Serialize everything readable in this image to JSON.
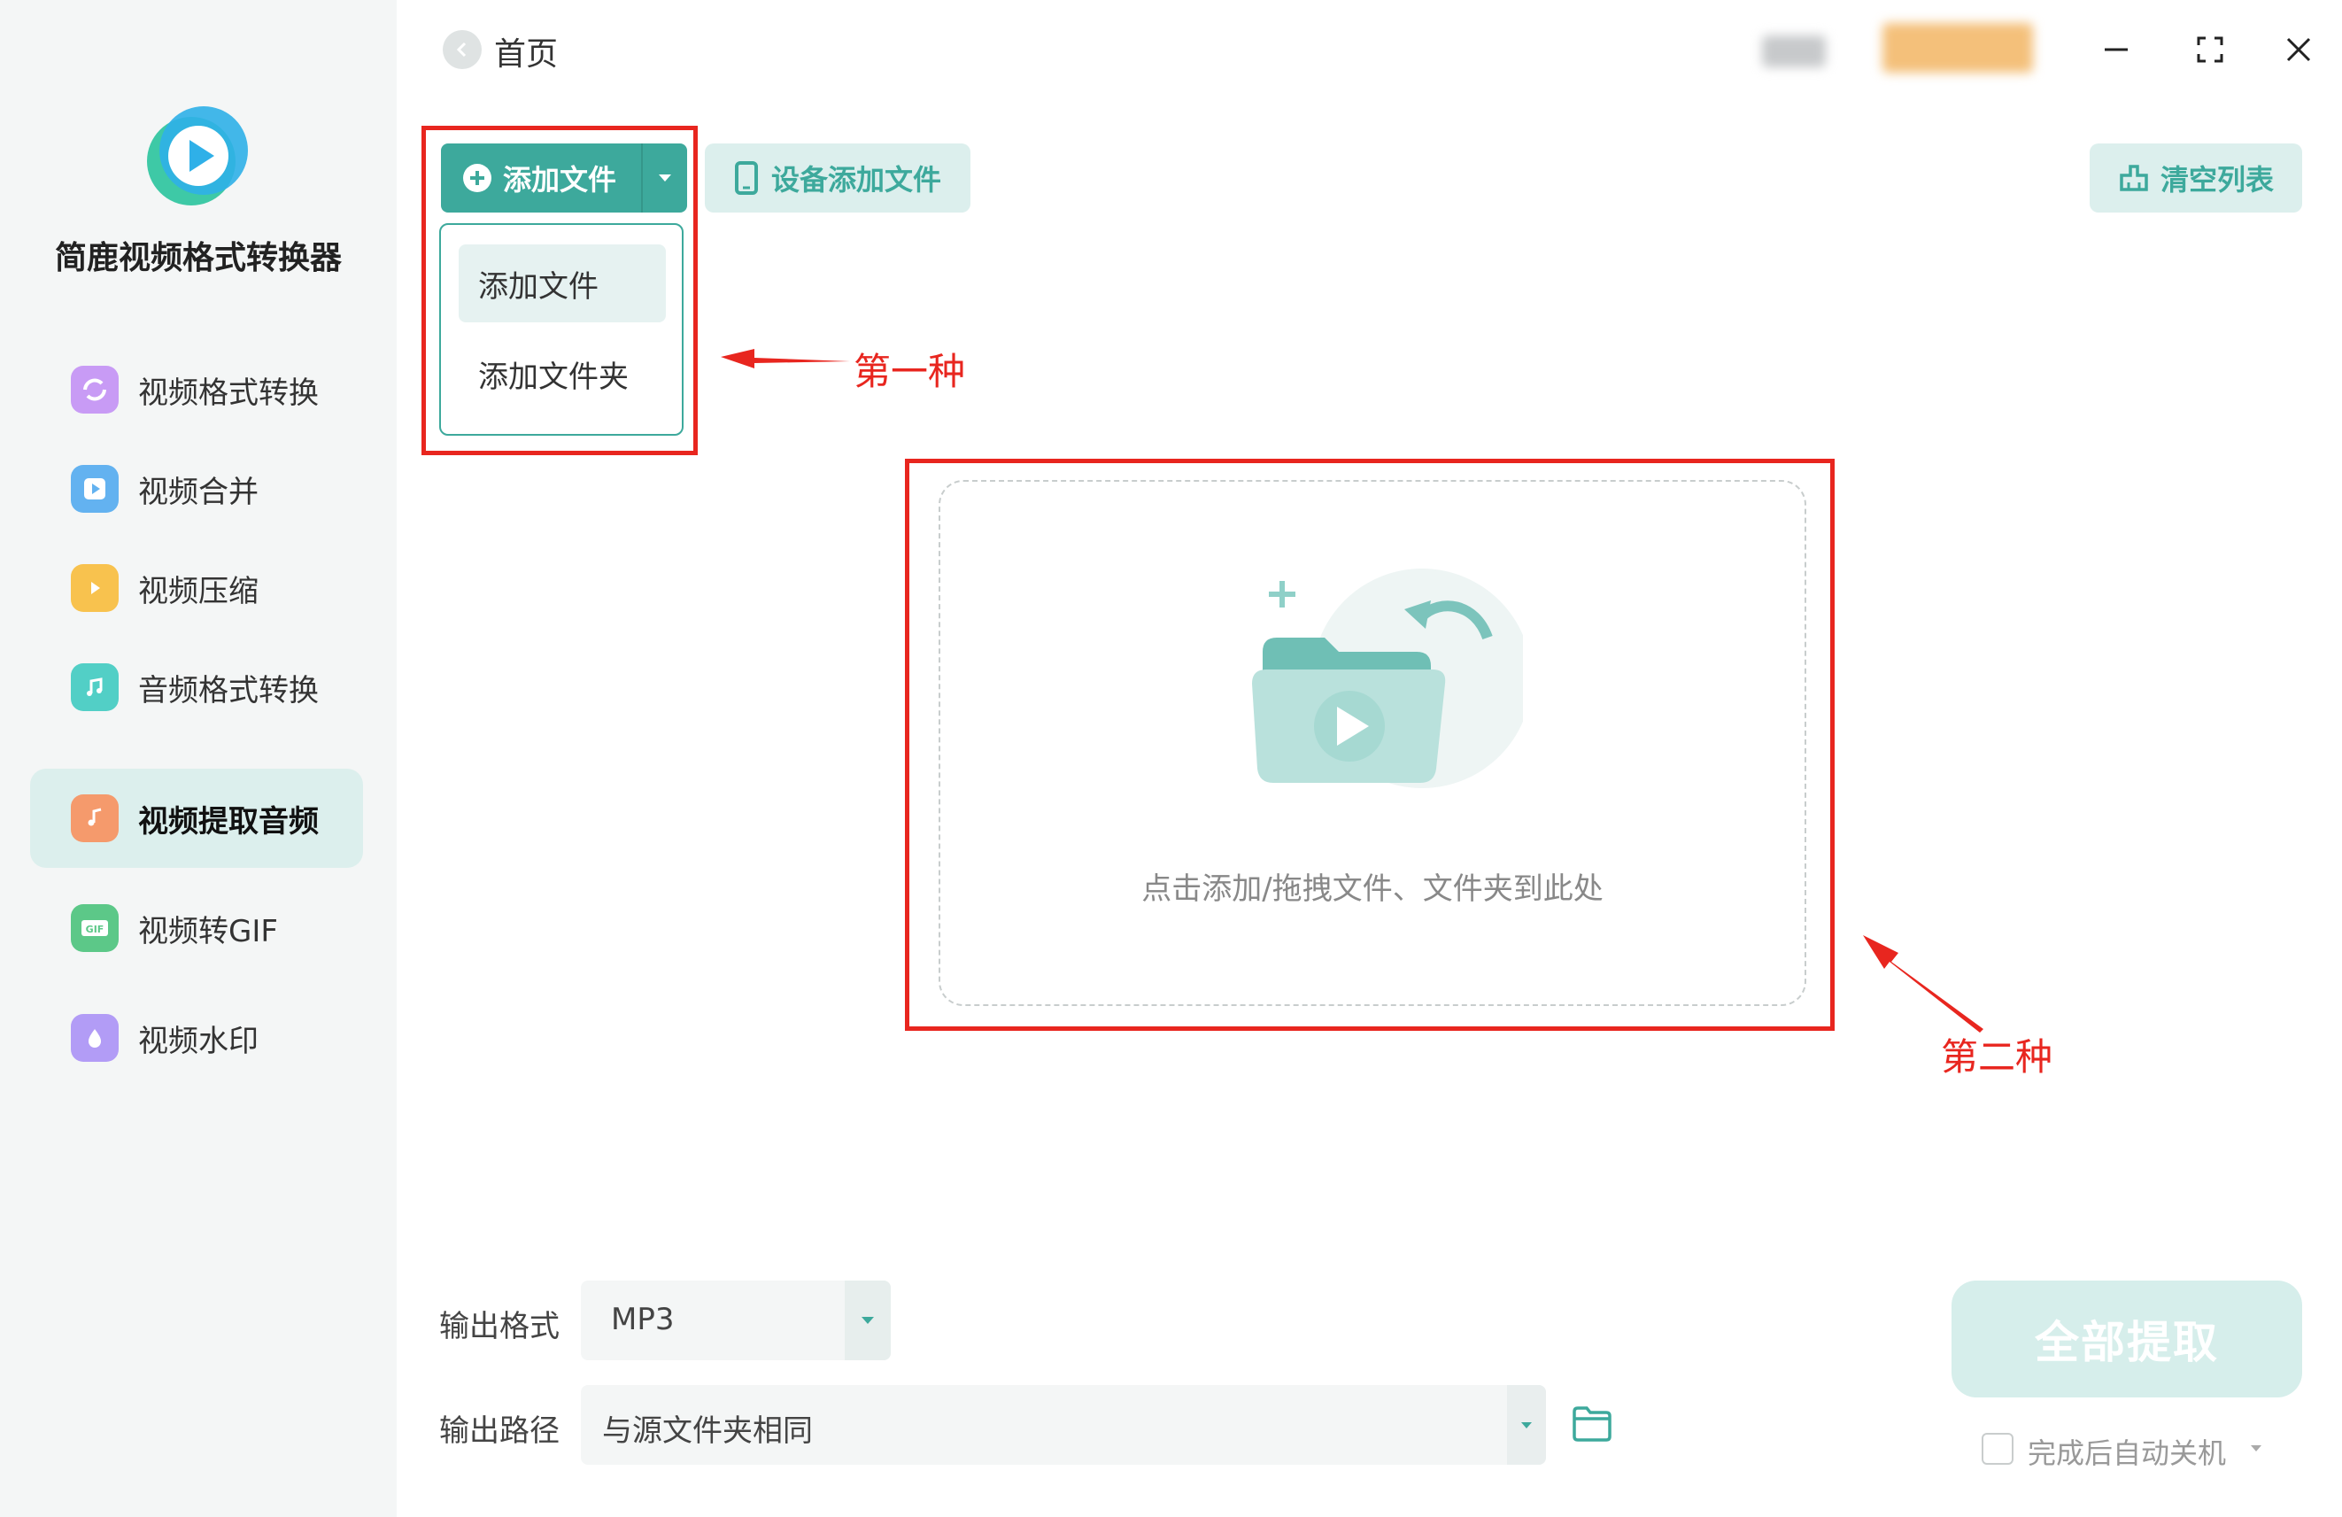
{
  "app": {
    "name": "简鹿视频格式转换器"
  },
  "sidebar": {
    "items": [
      {
        "label": "视频格式转换",
        "icon": "video-convert-icon",
        "color": "#b77bf0",
        "active": false
      },
      {
        "label": "视频合并",
        "icon": "video-merge-icon",
        "color": "#4fa6ee",
        "active": false
      },
      {
        "label": "视频压缩",
        "icon": "video-compress-icon",
        "color": "#f6b93b",
        "active": false
      },
      {
        "label": "音频格式转换",
        "icon": "audio-convert-icon",
        "color": "#3fc6c0",
        "active": false
      },
      {
        "label": "视频提取音频",
        "icon": "extract-audio-icon",
        "color": "#f2895a",
        "active": true
      },
      {
        "label": "视频转GIF",
        "icon": "gif-icon",
        "color": "#4cc07a",
        "active": false
      },
      {
        "label": "视频水印",
        "icon": "watermark-icon",
        "color": "#a78bf5",
        "active": false
      }
    ]
  },
  "header": {
    "breadcrumb": "首页"
  },
  "toolbar": {
    "add_file": "添加文件",
    "device_add": "设备添加文件",
    "clear_list": "清空列表"
  },
  "add_menu": {
    "items": [
      "添加文件",
      "添加文件夹"
    ]
  },
  "annotations": {
    "first": "第一种",
    "second": "第二种"
  },
  "drop_zone": {
    "hint": "点击添加/拖拽文件、文件夹到此处"
  },
  "settings": {
    "format_label": "输出格式",
    "format_value": "MP3",
    "path_label": "输出路径",
    "path_value": "与源文件夹相同"
  },
  "actions": {
    "extract_all": "全部提取",
    "shutdown_label": "完成后自动关机"
  },
  "colors": {
    "accent": "#3da99c",
    "accent_light": "#dcefed",
    "annotation": "#e8261f"
  }
}
